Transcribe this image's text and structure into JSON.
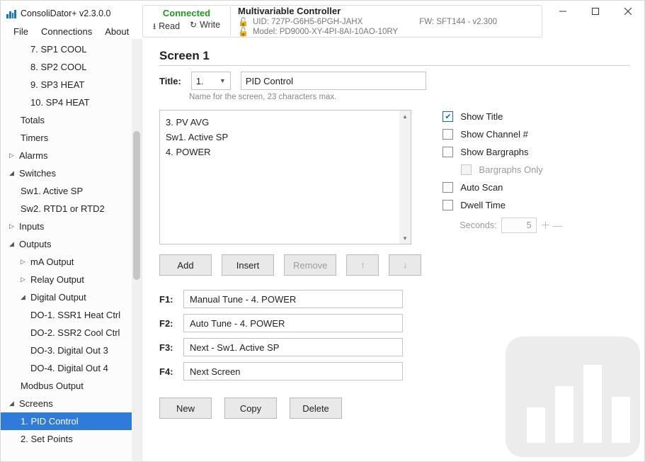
{
  "app": {
    "title": "ConsoliDator+ v2.3.0.0"
  },
  "menu": {
    "file": "File",
    "connections": "Connections",
    "about": "About"
  },
  "status": {
    "connected": "Connected",
    "read": "Read",
    "write": "Write"
  },
  "device": {
    "name": "Multivariable Controller",
    "uid_label": "UID:",
    "uid": "727P-G6H5-6PGH-JAHX",
    "fw_label": "FW:",
    "fw": "SFT144 - v2.300",
    "model_label": "Model:",
    "model": "PD9000-XY-4PI-8AI-10AO-10RY"
  },
  "tree": {
    "items": [
      {
        "lvl": "lvl3",
        "label": "7. SP1 COOL"
      },
      {
        "lvl": "lvl3",
        "label": "8. SP2 COOL"
      },
      {
        "lvl": "lvl3",
        "label": "9. SP3 HEAT"
      },
      {
        "lvl": "lvl3",
        "label": "10. SP4 HEAT"
      },
      {
        "lvl": "lvl2",
        "label": "Totals"
      },
      {
        "lvl": "lvl2",
        "label": "Timers"
      },
      {
        "lvl": "lvl1",
        "arrow": "▷",
        "label": "Alarms"
      },
      {
        "lvl": "lvl1",
        "arrow": "◢",
        "label": "Switches"
      },
      {
        "lvl": "lvl2",
        "label": "Sw1. Active SP"
      },
      {
        "lvl": "lvl2",
        "label": "Sw2. RTD1 or RTD2"
      },
      {
        "lvl": "lvl1",
        "arrow": "▷",
        "label": "Inputs"
      },
      {
        "lvl": "lvl1",
        "arrow": "◢",
        "label": "Outputs"
      },
      {
        "lvl": "lvl2",
        "arrow": "▷",
        "label": "mA Output"
      },
      {
        "lvl": "lvl2",
        "arrow": "▷",
        "label": "Relay Output"
      },
      {
        "lvl": "lvl2",
        "arrow": "◢",
        "label": "Digital Output"
      },
      {
        "lvl": "lvl3",
        "label": "DO-1. SSR1 Heat Ctrl"
      },
      {
        "lvl": "lvl3",
        "label": "DO-2. SSR2 Cool Ctrl"
      },
      {
        "lvl": "lvl3",
        "label": "DO-3. Digital Out 3"
      },
      {
        "lvl": "lvl3",
        "label": "DO-4. Digital Out 4"
      },
      {
        "lvl": "lvl2",
        "label": "Modbus Output"
      },
      {
        "lvl": "lvl1",
        "arrow": "◢",
        "label": "Screens"
      },
      {
        "lvl": "lvl2",
        "label": "1. PID Control",
        "sel": true
      },
      {
        "lvl": "lvl2",
        "label": "2. Set Points"
      }
    ]
  },
  "screen": {
    "heading": "Screen 1",
    "title_label": "Title:",
    "number": "1.",
    "name": "PID Control",
    "hint": "Name for the screen, 23 characters max.",
    "list": [
      "3. PV AVG",
      "Sw1. Active SP",
      "4. POWER"
    ]
  },
  "options": {
    "show_title": "Show Title",
    "show_channel": "Show Channel #",
    "show_bargraphs": "Show Bargraphs",
    "bargraphs_only": "Bargraphs Only",
    "auto_scan": "Auto Scan",
    "dwell_time": "Dwell Time",
    "seconds_label": "Seconds:",
    "seconds_value": "5"
  },
  "buttons": {
    "add": "Add",
    "insert": "Insert",
    "remove": "Remove",
    "new": "New",
    "copy": "Copy",
    "delete": "Delete",
    "up_arrow": "↑",
    "down_arrow": "↓"
  },
  "fkeys": {
    "f1l": "F1:",
    "f1v": "Manual Tune - 4. POWER",
    "f2l": "F2:",
    "f2v": "Auto Tune - 4. POWER",
    "f3l": "F3:",
    "f3v": "Next - Sw1. Active SP",
    "f4l": "F4:",
    "f4v": "Next Screen"
  }
}
